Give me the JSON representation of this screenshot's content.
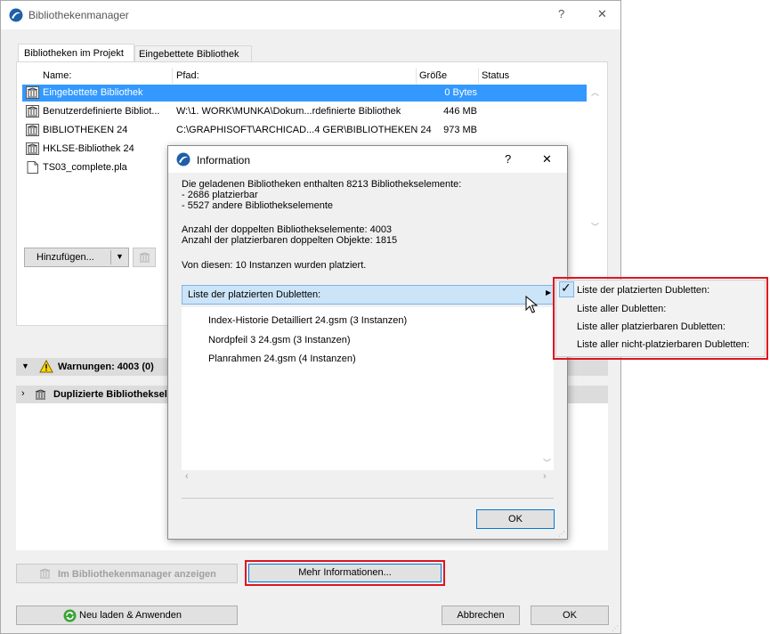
{
  "main": {
    "title": "Bibliothekenmanager",
    "help_glyph": "?",
    "close_glyph": "✕",
    "tabs": [
      {
        "label": "Bibliotheken im Projekt"
      },
      {
        "label": "Eingebettete Bibliothek"
      }
    ],
    "columns": {
      "name": "Name:",
      "path": "Pfad:",
      "size": "Größe",
      "status": "Status"
    },
    "rows": [
      {
        "name": "Eingebettete Bibliothek",
        "path": "",
        "size": "0 Bytes"
      },
      {
        "name": "Benutzerdefinierte Bibliot...",
        "path": "W:\\1. WORK\\MUNKA\\Dokum...rdefinierte Bibliothek",
        "size": "446 MB"
      },
      {
        "name": "BIBLIOTHEKEN 24",
        "path": "C:\\GRAPHISOFT\\ARCHICAD...4 GER\\BIBLIOTHEKEN 24",
        "size": "973 MB"
      },
      {
        "name": "HKLSE-Bibliothek 24",
        "path": "",
        "size": ""
      },
      {
        "name": "TS03_complete.pla",
        "path": "",
        "size": ""
      }
    ],
    "add_button": "Hinzufügen...",
    "warnings_label": "Warnungen: 4003 (0)",
    "duplicates_label": "Duplizierte Bibliothekselemente",
    "show_in_manager_button": "Im Bibliothekenmanager anzeigen",
    "more_info_button": "Mehr Informationen...",
    "reload_button": "Neu laden & Anwenden",
    "cancel_button": "Abbrechen",
    "ok_button": "OK"
  },
  "dialog": {
    "title": "Information",
    "help_glyph": "?",
    "close_glyph": "✕",
    "summary_lines": [
      "Die geladenen Bibliotheken enthalten 8213 Bibliothekselemente:",
      "- 2686 platzierbar",
      "- 5527 andere Bibliothekselemente"
    ],
    "duplicate_lines": [
      "Anzahl der doppelten Bibliothekselemente: 4003",
      "Anzahl der platzierbaren doppelten Objekte: 1815"
    ],
    "placed_line": "Von diesen: 10 Instanzen wurden platziert.",
    "dropdown_value": "Liste der platzierten Dubletten:",
    "items": [
      "Index-Historie Detailliert 24.gsm (3 Instanzen)",
      "Nordpfeil 3 24.gsm (3 Instanzen)",
      "Planrahmen 24.gsm (4 Instanzen)"
    ],
    "ok_button": "OK"
  },
  "popup_menu": {
    "items": [
      {
        "label": "Liste der platzierten Dubletten:",
        "checked": true
      },
      {
        "label": "Liste aller Dubletten:",
        "checked": false
      },
      {
        "label": "Liste aller platzierbaren Dubletten:",
        "checked": false
      },
      {
        "label": "Liste aller nicht-platzierbaren Dubletten:",
        "checked": false
      }
    ]
  },
  "colors": {
    "selection": "#3399ff",
    "highlight_box": "#e0141f",
    "focus": "#0078d7",
    "app_icon": "#1f5fa8"
  }
}
